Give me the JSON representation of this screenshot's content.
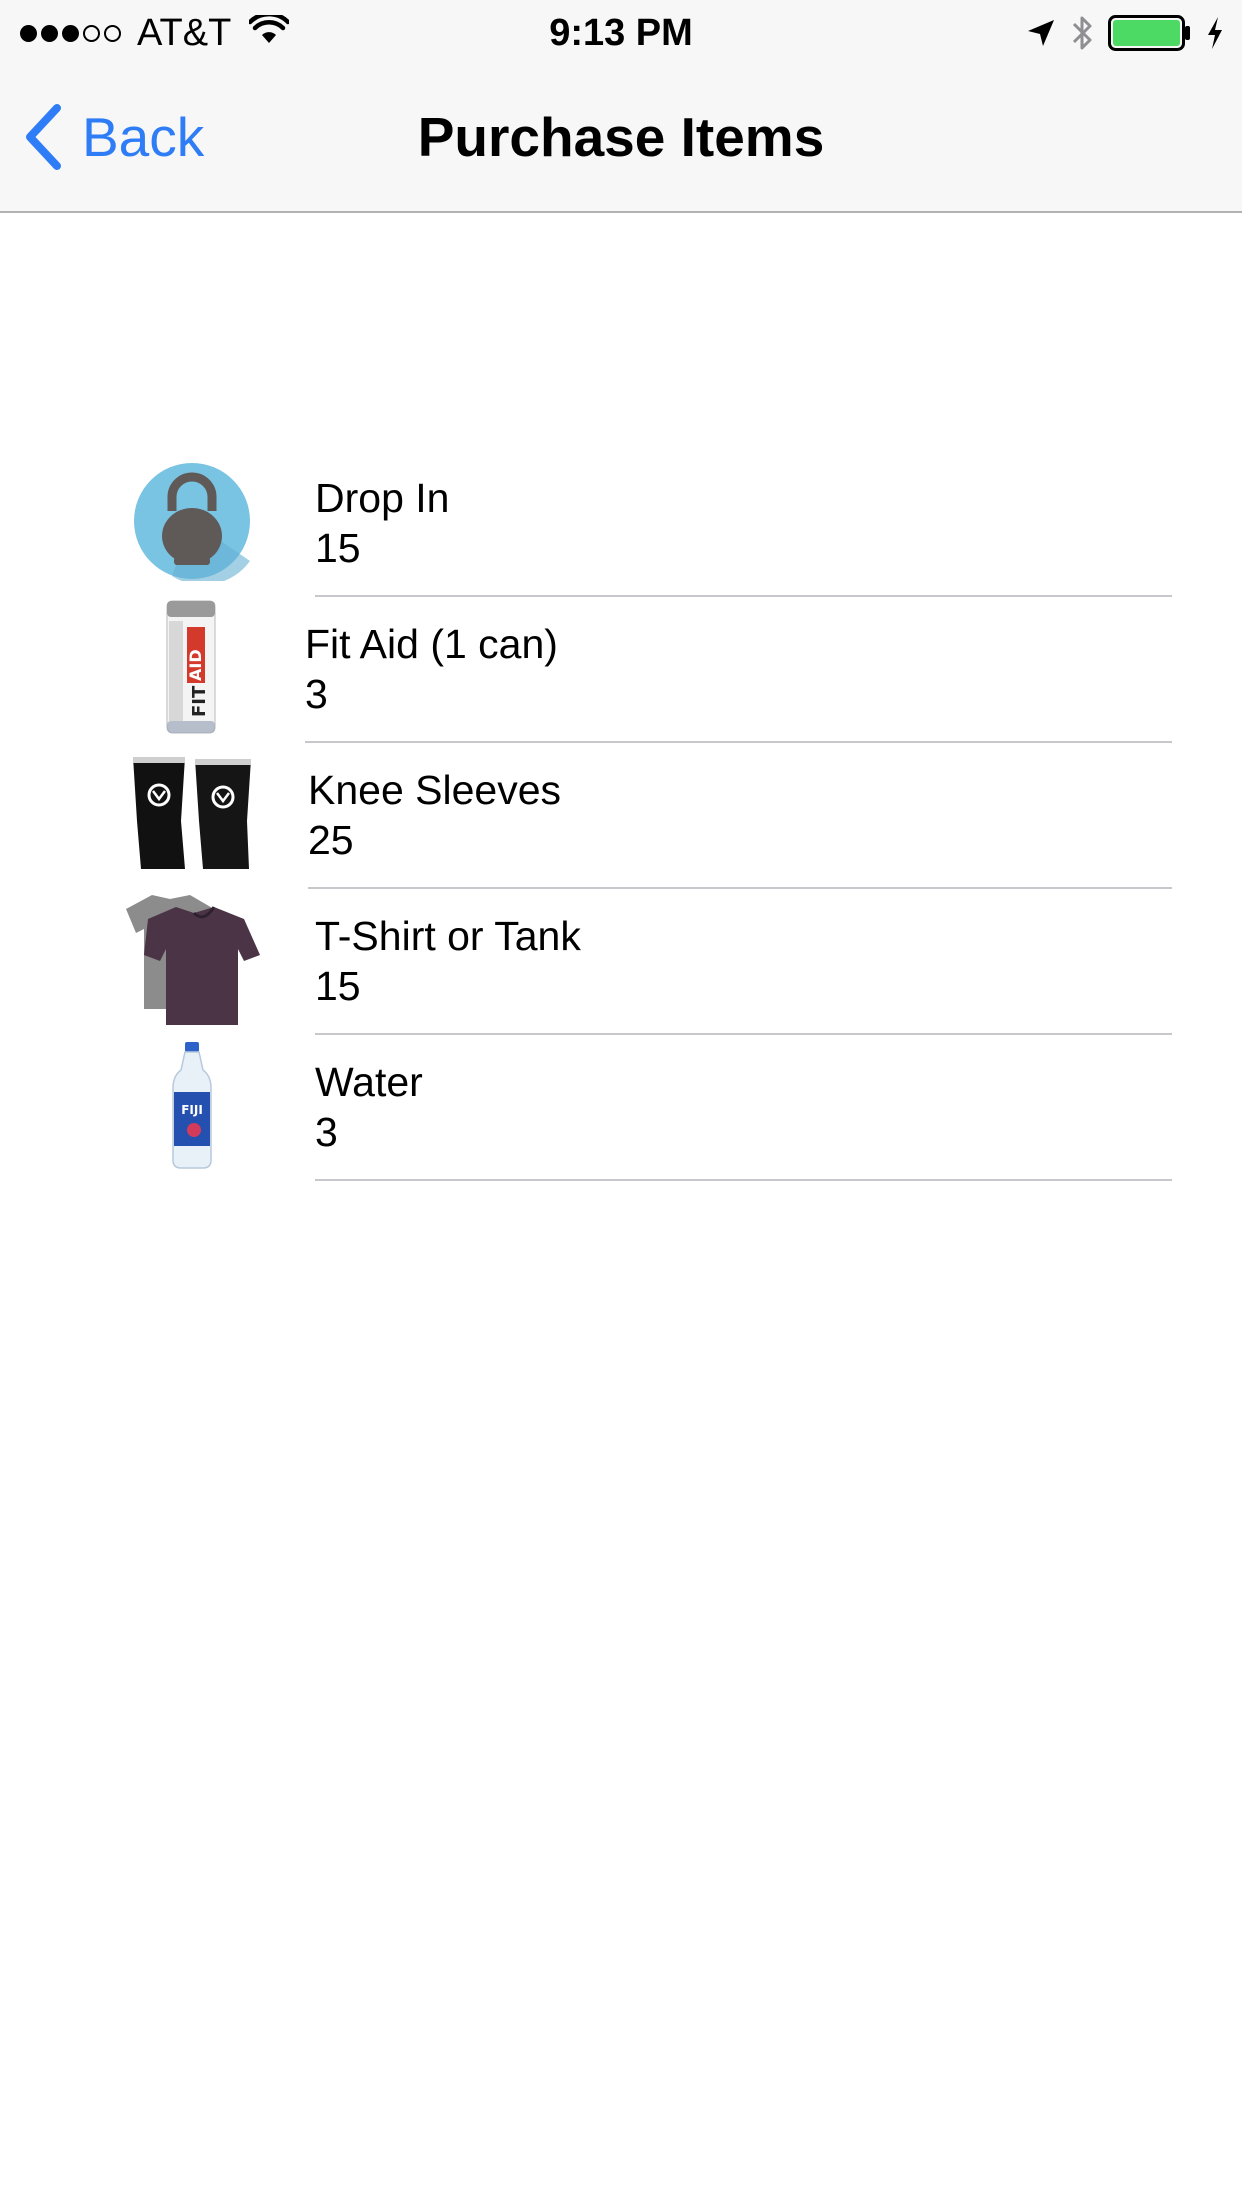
{
  "status_bar": {
    "carrier": "AT&T",
    "time": "9:13 PM",
    "signal_bars_filled": 3,
    "signal_bars_total": 5,
    "battery_level": 1.0,
    "battery_color": "#4cd964",
    "icons": [
      "wifi-icon",
      "location-arrow-icon",
      "bluetooth-icon",
      "battery-icon",
      "charging-bolt-icon"
    ]
  },
  "nav": {
    "back_label": "Back",
    "title": "Purchase Items",
    "accent_color": "#2f7df6"
  },
  "items": [
    {
      "name": "Drop In",
      "price": "15",
      "image": "kettlebell-image"
    },
    {
      "name": "Fit Aid (1 can)",
      "price": "3",
      "image": "fitaid-can-image"
    },
    {
      "name": "Knee Sleeves",
      "price": "25",
      "image": "knee-sleeves-image"
    },
    {
      "name": "T-Shirt or Tank",
      "price": "15",
      "image": "t-shirt-image"
    },
    {
      "name": "Water",
      "price": "3",
      "image": "water-bottle-image"
    }
  ]
}
